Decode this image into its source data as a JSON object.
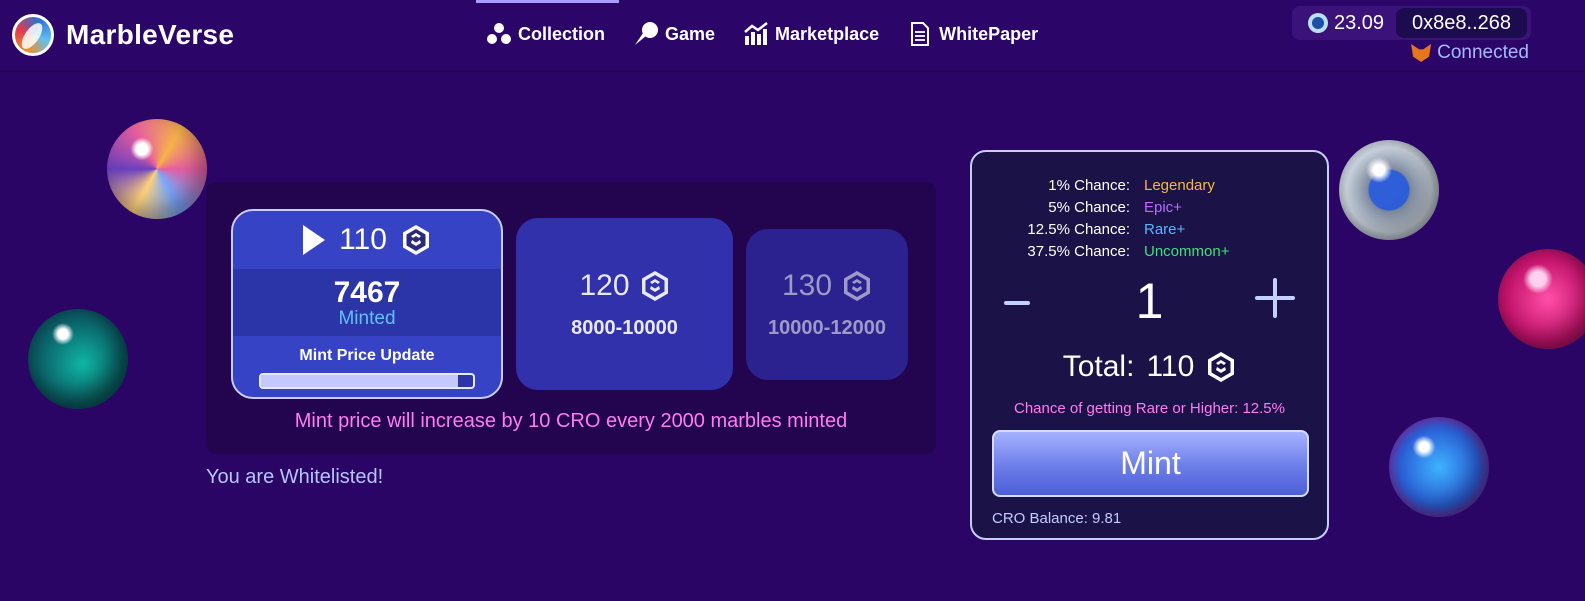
{
  "brand": {
    "name": "MarbleVerse"
  },
  "nav": [
    {
      "label": "Collection",
      "icon": "dots-icon",
      "active": true
    },
    {
      "label": "Game",
      "icon": "game-icon",
      "active": false
    },
    {
      "label": "Marketplace",
      "icon": "chart-icon",
      "active": false
    },
    {
      "label": "WhitePaper",
      "icon": "document-icon",
      "active": false
    }
  ],
  "wallet": {
    "balance": "23.09",
    "address": "0x8e8..268",
    "status": "Connected"
  },
  "tiers": {
    "active": {
      "price": "110",
      "minted_count": "7467",
      "minted_label": "Minted",
      "update_label": "Mint Price Update",
      "progress": 0.93
    },
    "next": [
      {
        "price": "120",
        "range": "8000-10000"
      },
      {
        "price": "130",
        "range": "10000-12000"
      }
    ],
    "note": "Mint price will increase by 10 CRO every 2000 marbles minted"
  },
  "whitelist": "You are Whitelisted!",
  "mint": {
    "chances": [
      {
        "pct": "1% Chance:",
        "tier": "Legendary"
      },
      {
        "pct": "5% Chance:",
        "tier": "Epic+"
      },
      {
        "pct": "12.5% Chance:",
        "tier": "Rare+"
      },
      {
        "pct": "37.5% Chance:",
        "tier": "Uncommon+"
      }
    ],
    "minus": "-",
    "plus": "+",
    "quantity": "1",
    "total_label": "Total:",
    "total_value": "110",
    "rare_note": "Chance of getting Rare or Higher: 12.5%",
    "button": "Mint",
    "balance": "CRO Balance: 9.81"
  },
  "colors": {
    "background": "#2a0566",
    "accent": "#3743c5",
    "legendary": "#f7b645",
    "epic": "#b86cff",
    "rare": "#5ab6ff",
    "uncommon": "#3fe07a",
    "highlight_text": "#ff7cf2"
  }
}
